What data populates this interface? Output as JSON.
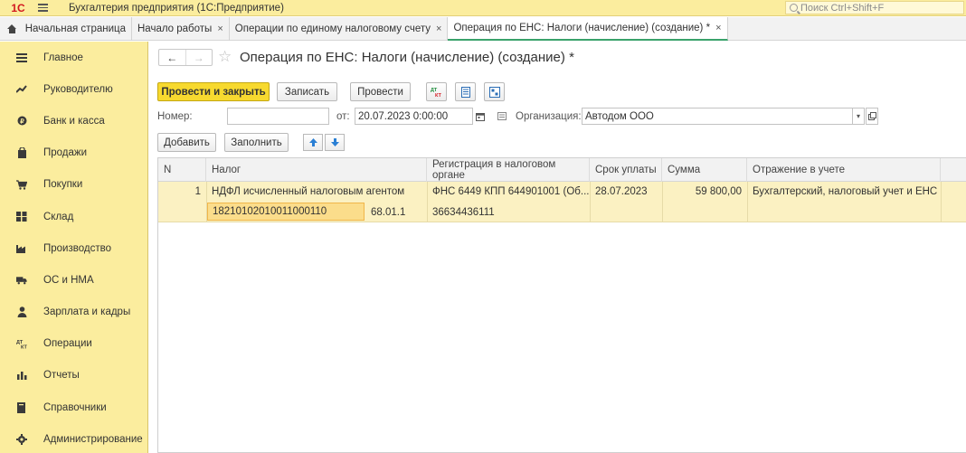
{
  "app": {
    "title": "Бухгалтерия предприятия  (1С:Предприятие)",
    "logo_text": "1С",
    "search_placeholder": "Поиск Ctrl+Shift+F"
  },
  "tabs": [
    {
      "label": "Начальная страница",
      "closable": false
    },
    {
      "label": "Начало работы",
      "close": "×"
    },
    {
      "label": "Операции по единому налоговому счету",
      "close": "×"
    },
    {
      "label": "Операция по ЕНС: Налоги (начисление) (создание) *",
      "close": "×",
      "active": true
    }
  ],
  "sidebar": {
    "items": [
      {
        "label": "Главное",
        "icon": "menu-icon"
      },
      {
        "label": "Руководителю",
        "icon": "trend-icon"
      },
      {
        "label": "Банк и касса",
        "icon": "coin-icon"
      },
      {
        "label": "Продажи",
        "icon": "bag-icon"
      },
      {
        "label": "Покупки",
        "icon": "cart-icon"
      },
      {
        "label": "Склад",
        "icon": "warehouse-icon"
      },
      {
        "label": "Производство",
        "icon": "factory-icon"
      },
      {
        "label": "ОС и НМА",
        "icon": "truck-icon"
      },
      {
        "label": "Зарплата и кадры",
        "icon": "person-icon"
      },
      {
        "label": "Операции",
        "icon": "dt-kt-icon"
      },
      {
        "label": "Отчеты",
        "icon": "bar-chart-icon"
      },
      {
        "label": "Справочники",
        "icon": "book-icon"
      },
      {
        "label": "Администрирование",
        "icon": "gear-icon"
      }
    ]
  },
  "document": {
    "title": "Операция по ЕНС: Налоги (начисление) (создание) *",
    "nav_back": "←",
    "nav_forward": "→",
    "star": "☆"
  },
  "toolbar": {
    "post_and_close": "Провести и закрыть",
    "save": "Записать",
    "post": "Провести",
    "dtkt": "Дт Кт"
  },
  "form": {
    "number_label": "Номер:",
    "number_value": "",
    "date_label": "от:",
    "date_value": "20.07.2023  0:00:00",
    "org_label": "Организация:",
    "org_value": "Автодом ООО"
  },
  "table_toolbar": {
    "add": "Добавить",
    "fill": "Заполнить"
  },
  "table": {
    "columns": [
      "N",
      "Налог",
      "Регистрация в налоговом органе",
      "Срок уплаты",
      "Сумма",
      "Отражение в учете"
    ],
    "rows": [
      {
        "n": "1",
        "tax": "НДФЛ исчисленный налоговым агентом",
        "kbk": "18210102010011000110",
        "account": "68.01.1",
        "registration": "ФНС 6449 КПП 644901001 (Об...",
        "oktmo": "36634436111",
        "due_date": "28.07.2023",
        "amount": "59 800,00",
        "accounting": "Бухгалтерский, налоговый учет и ЕНС"
      }
    ]
  }
}
